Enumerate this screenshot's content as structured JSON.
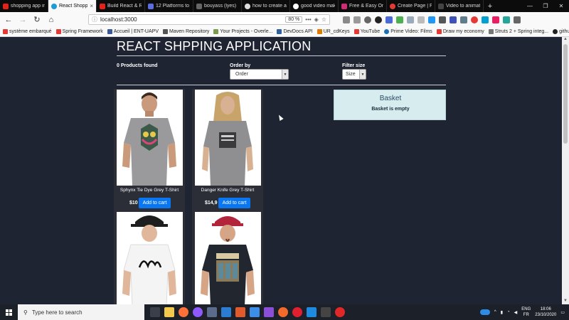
{
  "browser": {
    "tabs": [
      {
        "title": "shopping app in",
        "color": "#e62117",
        "active": false
      },
      {
        "title": "React Shopp",
        "color": "#1f9bd7",
        "active": true
      },
      {
        "title": "Build React & R",
        "color": "#e62117",
        "active": false
      },
      {
        "title": "12 Platforms to",
        "color": "#5b6de0",
        "active": false
      },
      {
        "title": "bouyass (lyes)",
        "color": "#666666",
        "active": false
      },
      {
        "title": "how to create a",
        "color": "#dddddd",
        "active": false
      },
      {
        "title": "good video mak",
        "color": "#ffffff",
        "active": false
      },
      {
        "title": "Free & Easy Onl",
        "color": "#d02b73",
        "active": false
      },
      {
        "title": "Create Page | Fr",
        "color": "#e53935",
        "active": false
      },
      {
        "title": "Video to animat",
        "color": "#444444",
        "active": false
      }
    ],
    "tab_close": "×",
    "new_tab": "+",
    "window_controls": [
      "—",
      "❐",
      "✕"
    ],
    "url": "localhost:3000",
    "zoom": "80 %",
    "url_more": "•••",
    "bookmarks": [
      {
        "label": "système embarqué",
        "color": "#e53935"
      },
      {
        "label": "Spring Framework",
        "color": "#e53935"
      },
      {
        "label": "Accueil | ENT-UAPV",
        "color": "#3b5998"
      },
      {
        "label": "Maven Repository",
        "color": "#555555"
      },
      {
        "label": "Your Projects - Overle...",
        "color": "#7a9a4f"
      },
      {
        "label": "DevDocs API",
        "color": "#3060a0"
      },
      {
        "label": "UR_cdKeys",
        "color": "#e07b00"
      },
      {
        "label": "YouTube",
        "color": "#e53935"
      },
      {
        "label": "Prime Video: Films",
        "color": "#1a6fb5"
      },
      {
        "label": "Draw my economy",
        "color": "#e53935"
      },
      {
        "label": "Struts 2 + Spring integ...",
        "color": "#777777"
      },
      {
        "label": "github",
        "color": "#222222"
      }
    ]
  },
  "app": {
    "title": "REACT SHPPING APPLICATION",
    "products_found": "0 Products found",
    "order_label": "Order by",
    "order_value": "Order",
    "size_label": "Filter size",
    "size_value": "Size",
    "products": [
      {
        "name": "Sphynx Tie Dye Grey T-Shirt",
        "price": "$10",
        "cart": "Add to cart"
      },
      {
        "name": "Danger Knife Grey T-Shirt",
        "price": "$14,9",
        "cart": "Add to cart"
      },
      {
        "name": "",
        "price": "",
        "cart": ""
      },
      {
        "name": "",
        "price": "",
        "cart": ""
      }
    ],
    "basket_title": "Basket",
    "basket_empty": "Basket is empty"
  },
  "taskbar": {
    "search_placeholder": "Type here to search",
    "lang_top": "ENG",
    "lang_bottom": "FR",
    "time": "18:06",
    "date": "23/10/2020"
  }
}
